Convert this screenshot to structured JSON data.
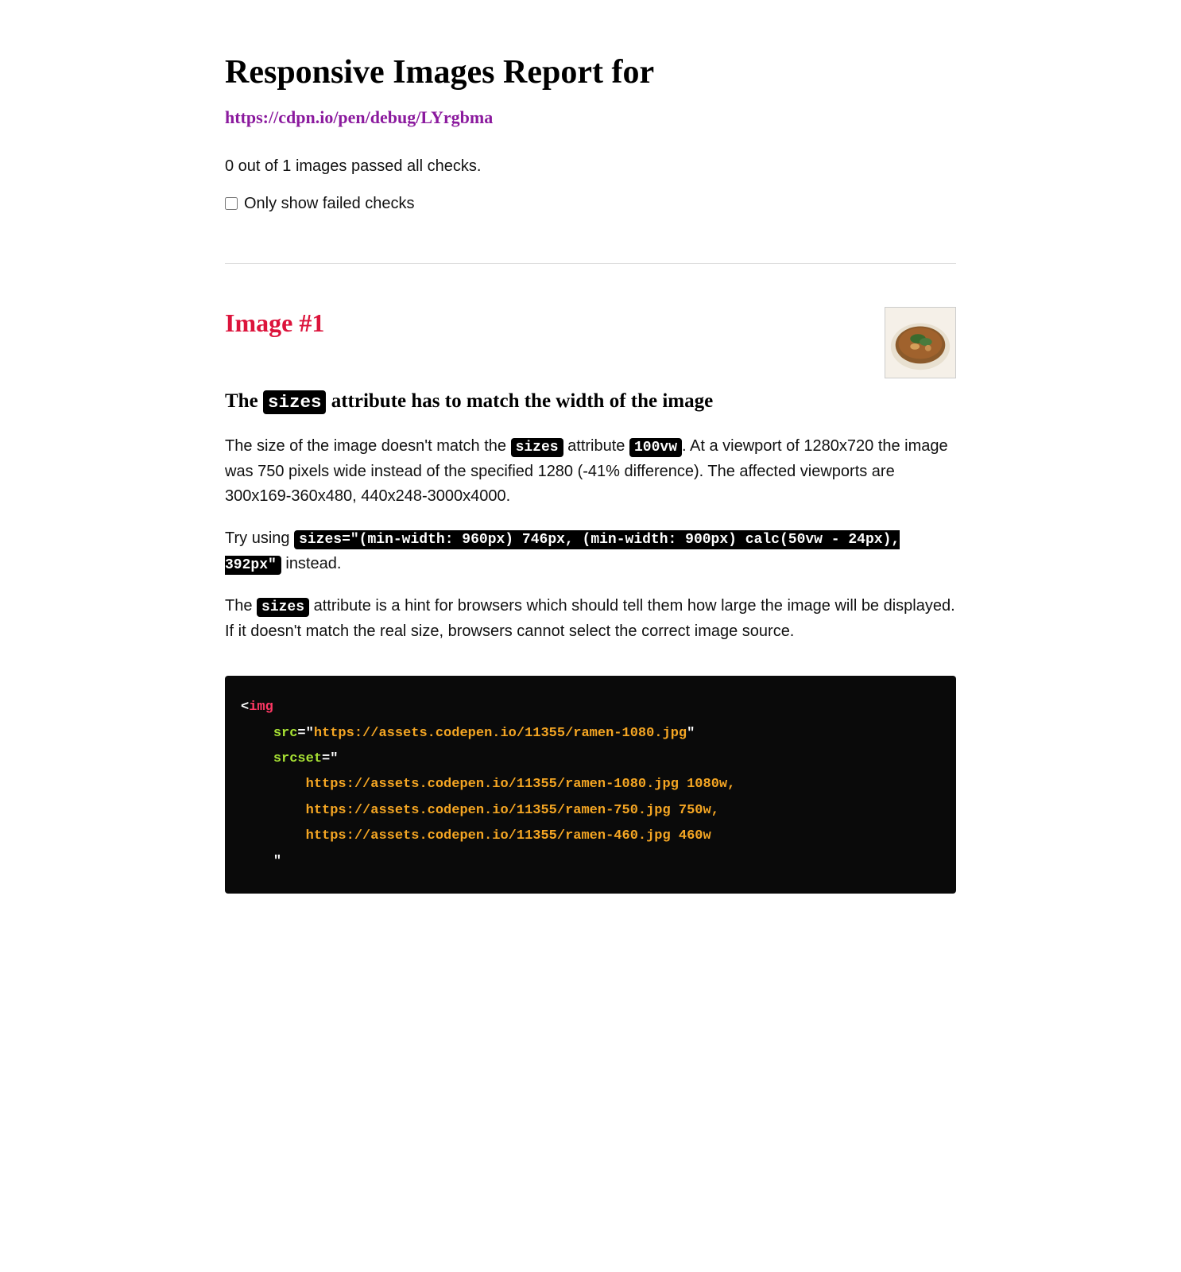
{
  "header": {
    "title": "Responsive Images Report for",
    "url": "https://cdpn.io/pen/debug/LYrgbma"
  },
  "summary": "0 out of 1 images passed all checks.",
  "filter": {
    "label": "Only show failed checks"
  },
  "image": {
    "heading": "Image #1",
    "check": {
      "title_pre": "The ",
      "title_code": "sizes",
      "title_post": " attribute has to match the width of the image",
      "p1_pre": "The size of the image doesn't match the ",
      "p1_code1": "sizes",
      "p1_mid": " attribute ",
      "p1_code2": "100vw",
      "p1_post": ". At a viewport of 1280x720 the image was 750 pixels wide instead of the specified 1280 (-41% difference). The affected viewports are 300x169-360x480, 440x248-3000x4000.",
      "p2_pre": "Try using ",
      "p2_code": "sizes=\"(min-width: 960px) 746px, (min-width: 900px) calc(50vw - 24px), 392px\"",
      "p2_post": " instead.",
      "p3_pre": "The ",
      "p3_code": "sizes",
      "p3_post": " attribute is a hint for browsers which should tell them how large the image will be displayed. If it doesn't match the real size, browsers cannot select the correct image source."
    },
    "code": {
      "tag": "img",
      "src_attr": "src",
      "src_val": "https://assets.codepen.io/11355/ramen-1080.jpg",
      "srcset_attr": "srcset",
      "srcset_lines": [
        {
          "url": "https://assets.codepen.io/11355/ramen-1080.jpg",
          "w": "1080w",
          "trail": ","
        },
        {
          "url": "https://assets.codepen.io/11355/ramen-750.jpg",
          "w": "750w",
          "trail": ","
        },
        {
          "url": "https://assets.codepen.io/11355/ramen-460.jpg",
          "w": "460w",
          "trail": ""
        }
      ]
    }
  }
}
